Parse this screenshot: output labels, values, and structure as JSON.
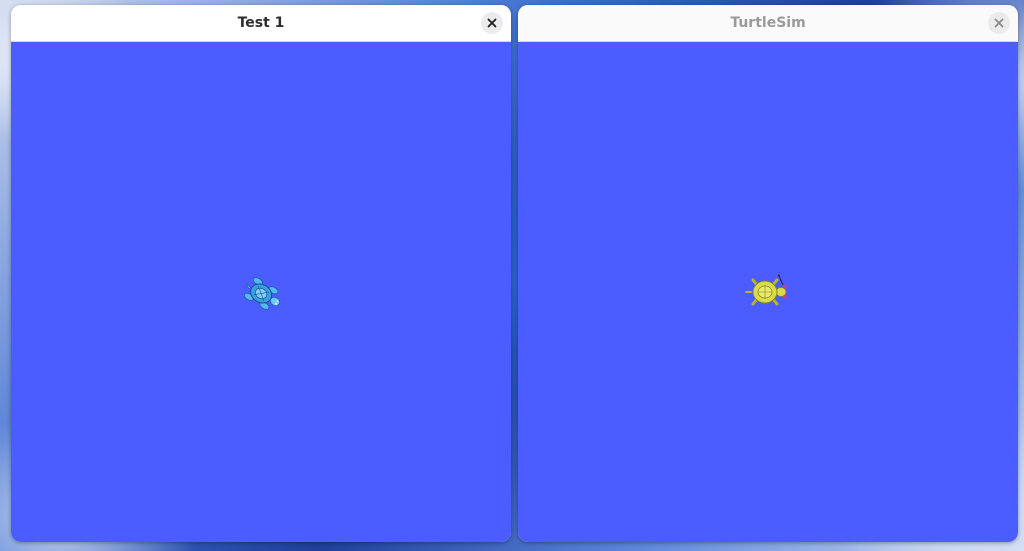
{
  "windows": [
    {
      "title": "Test 1",
      "active": true,
      "canvas_color": "#4b5dff",
      "close_icon": "close-icon",
      "turtle": {
        "color": "#3a9fe0",
        "icon": "turtle-icon"
      }
    },
    {
      "title": "TurtleSim",
      "active": false,
      "canvas_color": "#4b5dff",
      "close_icon": "close-icon",
      "turtle": {
        "color": "#d8dc4a",
        "icon": "turtle-icon"
      }
    }
  ]
}
